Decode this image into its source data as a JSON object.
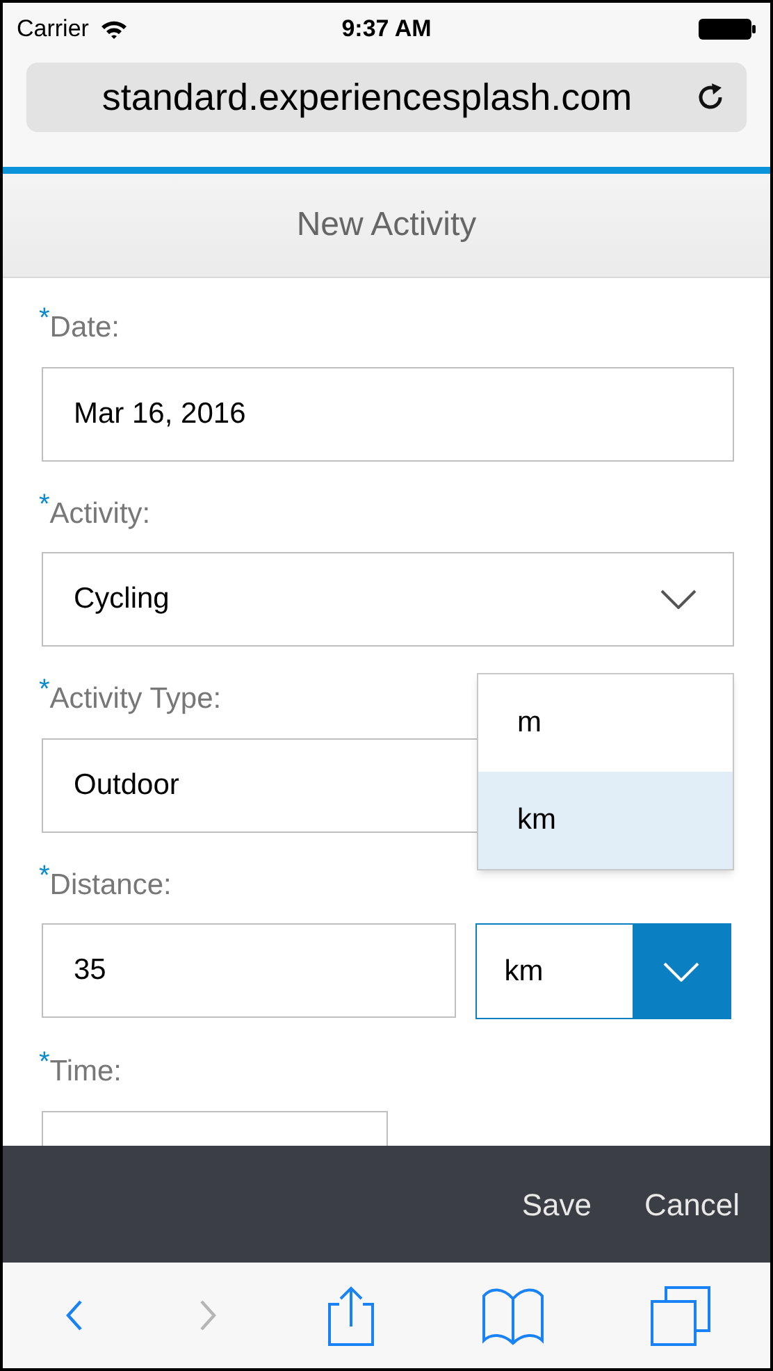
{
  "status_bar": {
    "carrier": "Carrier",
    "time": "9:37 AM"
  },
  "browser": {
    "url": "standard.experiencesplash.com"
  },
  "header": {
    "title": "New Activity"
  },
  "fields": [
    {
      "kind": "text",
      "required_mark": "*",
      "label": "Date:",
      "value": "Mar 16, 2016"
    },
    {
      "kind": "select",
      "required_mark": "*",
      "label": "Activity:",
      "value": "Cycling"
    },
    {
      "kind": "select",
      "required_mark": "*",
      "label": "Activity Type:",
      "value": "Outdoor"
    },
    {
      "kind": "unit",
      "required_mark": "*",
      "label": "Distance:",
      "value": "35",
      "unit": "km",
      "expanded": true
    },
    {
      "kind": "text",
      "required_mark": "*",
      "label": "Time:"
    }
  ],
  "unit_options": [
    {
      "label": "m",
      "selected": false
    },
    {
      "label": "km",
      "selected": true
    }
  ],
  "footer": {
    "buttons": [
      "Save",
      "Cancel"
    ]
  },
  "toolbar": [
    {
      "kind": "back",
      "disabled": false
    },
    {
      "kind": "forward",
      "disabled": true
    },
    {
      "kind": "share",
      "disabled": false
    },
    {
      "kind": "bookmarks",
      "disabled": false
    },
    {
      "kind": "tabs",
      "disabled": false
    }
  ]
}
